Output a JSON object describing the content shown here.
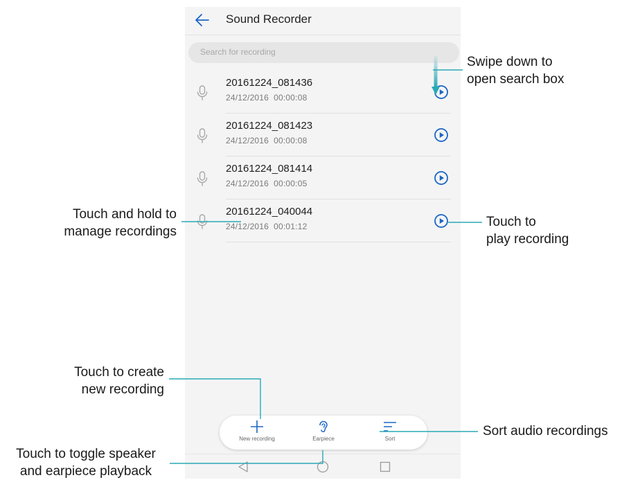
{
  "app": {
    "title": "Sound Recorder",
    "search_placeholder": "Search for recording"
  },
  "recordings": [
    {
      "name": "20161224_081436",
      "date": "24/12/2016",
      "duration": "00:00:08"
    },
    {
      "name": "20161224_081423",
      "date": "24/12/2016",
      "duration": "00:00:08"
    },
    {
      "name": "20161224_081414",
      "date": "24/12/2016",
      "duration": "00:00:05"
    },
    {
      "name": "20161224_040044",
      "date": "24/12/2016",
      "duration": "00:01:12"
    }
  ],
  "bottom_bar": {
    "new_recording": "New recording",
    "earpiece": "Earpiece",
    "sort": "Sort"
  },
  "callouts": {
    "swipe_line1": "Swipe down to",
    "swipe_line2": "open search box",
    "hold_line1": "Touch and hold to",
    "hold_line2": "manage recordings",
    "play_line1": "Touch to",
    "play_line2": "play recording",
    "create_line1": "Touch to create",
    "create_line2": "new recording",
    "sort_line": "Sort audio recordings",
    "toggle_line1": "Touch to toggle speaker",
    "toggle_line2": "and earpiece playback"
  },
  "colors": {
    "accent": "#1a66c4",
    "callout_line": "#2aa9b4"
  },
  "icons": [
    "back-arrow-icon",
    "microphone-icon",
    "play-icon",
    "add-icon",
    "earpiece-icon",
    "sort-icon",
    "nav-back-icon",
    "nav-home-icon",
    "nav-recents-icon"
  ]
}
